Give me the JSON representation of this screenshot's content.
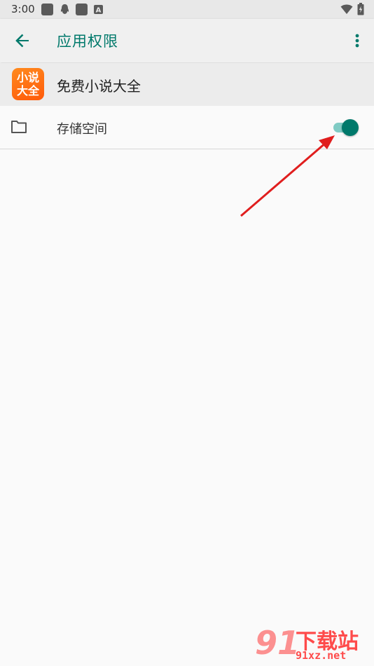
{
  "status_bar": {
    "time": "3:00",
    "icons": [
      "notification-square-icon",
      "qq-penguin-icon",
      "notification-square-icon",
      "a-letter-icon",
      "wifi-icon",
      "battery-charging-icon"
    ]
  },
  "app_bar": {
    "title": "应用权限",
    "back_icon": "arrow-back-icon",
    "overflow_icon": "more-vert-icon"
  },
  "app_header": {
    "icon_text_line1": "小说",
    "icon_text_line2": "大全",
    "app_name": "免费小说大全"
  },
  "permissions": [
    {
      "icon": "folder-icon",
      "label": "存储空间",
      "enabled": true
    }
  ],
  "colors": {
    "accent": "#00796b",
    "track_on": "#80cbc4",
    "annotation_arrow": "#e01e1e",
    "app_icon": "#ff6a10"
  },
  "watermark": {
    "text": "下载站",
    "url": "91xz.net"
  }
}
